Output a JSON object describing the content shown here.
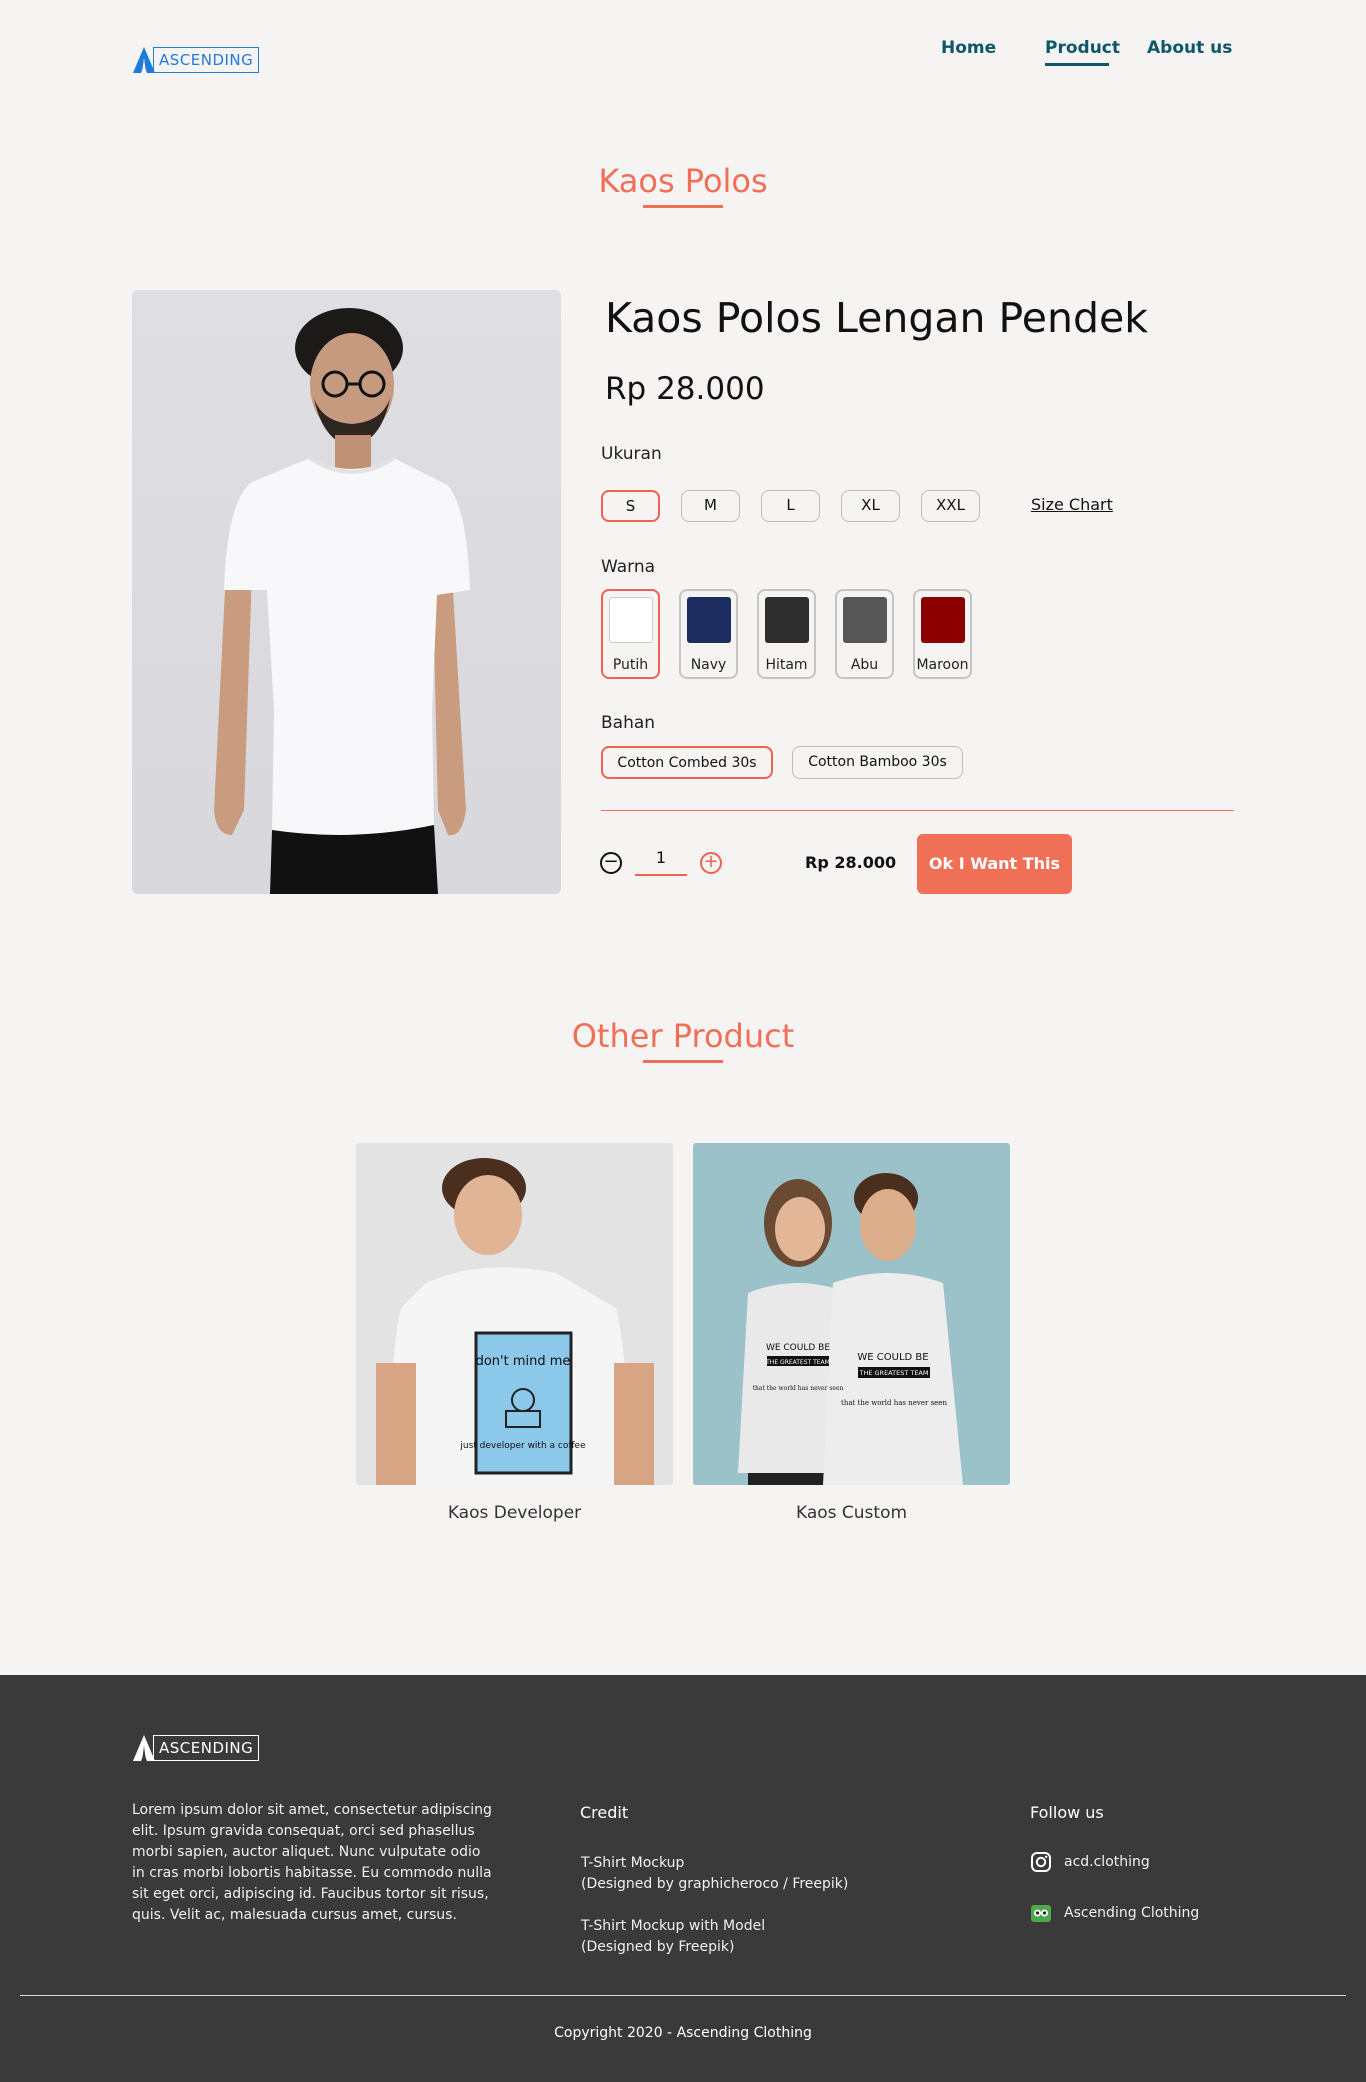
{
  "brand": {
    "name": "ASCENDING"
  },
  "nav": {
    "home": "Home",
    "product": "Product",
    "about": "About us"
  },
  "product_section": {
    "title": "Kaos Polos"
  },
  "product": {
    "name": "Kaos Polos Lengan Pendek",
    "price": "Rp 28.000",
    "size_label": "Ukuran",
    "sizes": [
      "S",
      "M",
      "L",
      "XL",
      "XXL"
    ],
    "selected_size": "S",
    "size_chart": "Size Chart",
    "color_label": "Warna",
    "colors": [
      {
        "name": "Putih",
        "hex": "#ffffff"
      },
      {
        "name": "Navy",
        "hex": "#1d2c5e"
      },
      {
        "name": "Hitam",
        "hex": "#2d2d2d"
      },
      {
        "name": "Abu",
        "hex": "#575757"
      },
      {
        "name": "Maroon",
        "hex": "#8a0000"
      }
    ],
    "selected_color": "Putih",
    "material_label": "Bahan",
    "materials": [
      "Cotton Combed 30s",
      "Cotton Bamboo 30s"
    ],
    "selected_material": "Cotton Combed 30s",
    "quantity": "1",
    "total": "Rp 28.000",
    "buy_button": "Ok I Want This"
  },
  "other_section": {
    "title": "Other Product",
    "items": [
      {
        "name": "Kaos Developer",
        "shirt_text_top": "don't mind me",
        "shirt_text_bottom": "just developer with a coffee"
      },
      {
        "name": "Kaos Custom",
        "shirt_text_top": "WE COULD BE",
        "shirt_text_mid": "THE GREATEST TEAM",
        "shirt_text_bottom": "that the world has never seen"
      }
    ]
  },
  "footer": {
    "about": "Lorem ipsum dolor sit amet, consectetur adipiscing elit. Ipsum gravida consequat, orci sed phasellus morbi sapien, auctor aliquet. Nunc vulputate odio in cras morbi lobortis habitasse. Eu commodo nulla sit eget orci, adipiscing id. Faucibus tortor sit risus, quis. Velit ac, malesuada cursus amet, cursus.",
    "credit_title": "Credit",
    "credits": [
      {
        "line1": "T-Shirt Mockup",
        "line2": "(Designed by graphicheroco / Freepik)"
      },
      {
        "line1": "T-Shirt Mockup with Model",
        "line2": "(Designed by Freepik)"
      }
    ],
    "follow_title": "Follow us",
    "socials": [
      {
        "icon": "instagram-icon",
        "label": "acd.clothing"
      },
      {
        "icon": "tokopedia-icon",
        "label": "Ascending Clothing"
      }
    ],
    "copyright": "Copyright 2020 - Ascending Clothing"
  },
  "colors": {
    "accent": "#ef7057",
    "nav": "#0f5668",
    "brand_blue": "#1f7bd8",
    "footer_bg": "#3a3a3a"
  }
}
